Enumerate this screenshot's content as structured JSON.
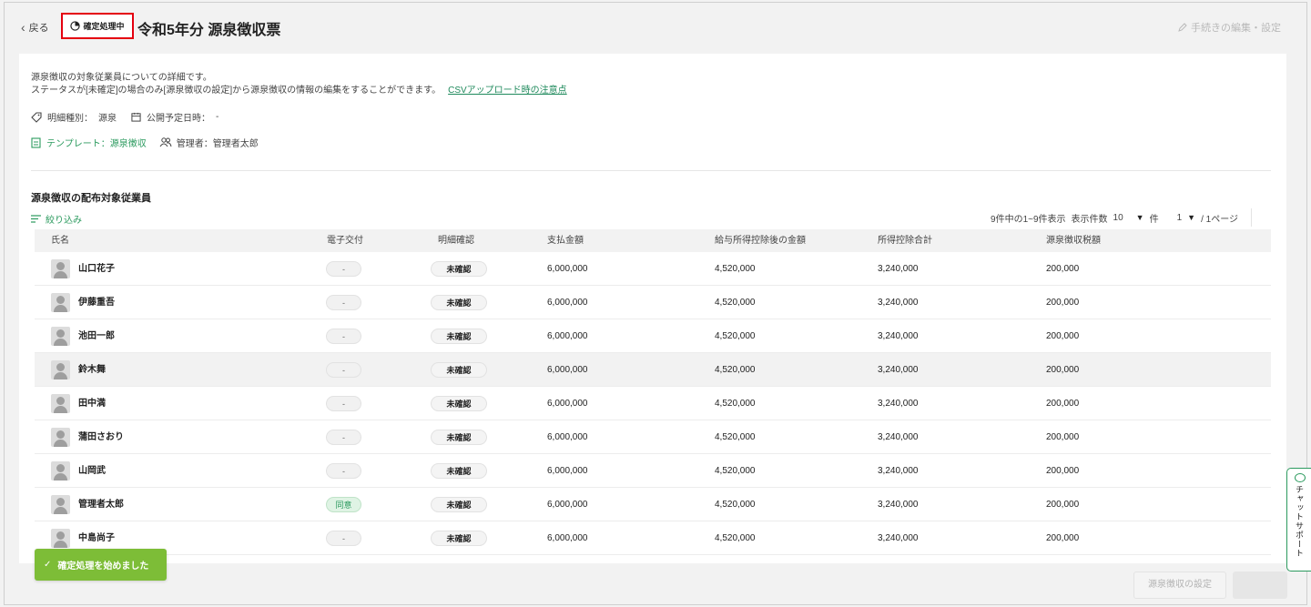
{
  "header": {
    "back_label": "戻る",
    "status_label": "確定処理中",
    "title": "令和5年分 源泉徴収票",
    "edit_link": "手続きの編集・設定"
  },
  "description": {
    "line1": "源泉徴収の対象従業員についての詳細です。",
    "line2": "ステータスが[未確定]の場合のみ[源泉徴収の設定]から源泉徴収の情報の編集をすることができます。",
    "csv_link": "CSVアップロード時の注意点"
  },
  "meta": {
    "type_label": "明細種別：",
    "type_value": "源泉",
    "publish_label": "公開予定日時：",
    "publish_value": "-",
    "template_label": "テンプレート：源泉徴収",
    "manager_label": "管理者：管理者太郎"
  },
  "section_title": "源泉徴収の配布対象従業員",
  "filter_label": "絞り込み",
  "pager": {
    "summary": "9件中の1~9件表示",
    "per_page_label": "表示件数",
    "per_page_value": "10",
    "per_page_unit": "件",
    "page_value": "1",
    "page_suffix": "/ 1ページ"
  },
  "table": {
    "headers": [
      "氏名",
      "電子交付",
      "明細確認",
      "支払金額",
      "給与所得控除後の金額",
      "所得控除合計",
      "源泉徴収税額"
    ],
    "rows": [
      {
        "name": "山口花子",
        "e_delivery": "-",
        "confirm": "未確認",
        "payment": "6,000,000",
        "after_deduction": "4,520,000",
        "deduction_total": "3,240,000",
        "tax": "200,000"
      },
      {
        "name": "伊藤重吾",
        "e_delivery": "-",
        "confirm": "未確認",
        "payment": "6,000,000",
        "after_deduction": "4,520,000",
        "deduction_total": "3,240,000",
        "tax": "200,000"
      },
      {
        "name": "池田一郎",
        "e_delivery": "-",
        "confirm": "未確認",
        "payment": "6,000,000",
        "after_deduction": "4,520,000",
        "deduction_total": "3,240,000",
        "tax": "200,000"
      },
      {
        "name": "鈴木舞",
        "e_delivery": "-",
        "confirm": "未確認",
        "payment": "6,000,000",
        "after_deduction": "4,520,000",
        "deduction_total": "3,240,000",
        "tax": "200,000"
      },
      {
        "name": "田中満",
        "e_delivery": "-",
        "confirm": "未確認",
        "payment": "6,000,000",
        "after_deduction": "4,520,000",
        "deduction_total": "3,240,000",
        "tax": "200,000"
      },
      {
        "name": "蒲田さおり",
        "e_delivery": "-",
        "confirm": "未確認",
        "payment": "6,000,000",
        "after_deduction": "4,520,000",
        "deduction_total": "3,240,000",
        "tax": "200,000"
      },
      {
        "name": "山岡武",
        "e_delivery": "-",
        "confirm": "未確認",
        "payment": "6,000,000",
        "after_deduction": "4,520,000",
        "deduction_total": "3,240,000",
        "tax": "200,000"
      },
      {
        "name": "管理者太郎",
        "e_delivery": "同意",
        "confirm": "未確認",
        "payment": "6,000,000",
        "after_deduction": "4,520,000",
        "deduction_total": "3,240,000",
        "tax": "200,000"
      },
      {
        "name": "中島尚子",
        "e_delivery": "-",
        "confirm": "未確認",
        "payment": "6,000,000",
        "after_deduction": "4,520,000",
        "deduction_total": "3,240,000",
        "tax": "200,000"
      }
    ]
  },
  "toast": "確定処理を始めました",
  "footer": {
    "settings_button": "源泉徴収の設定"
  },
  "chat_support": "チャットサポート",
  "colors": {
    "accent_green": "#2b9a5e",
    "toast_green": "#7dbd37",
    "highlight_red": "#e4000f"
  }
}
